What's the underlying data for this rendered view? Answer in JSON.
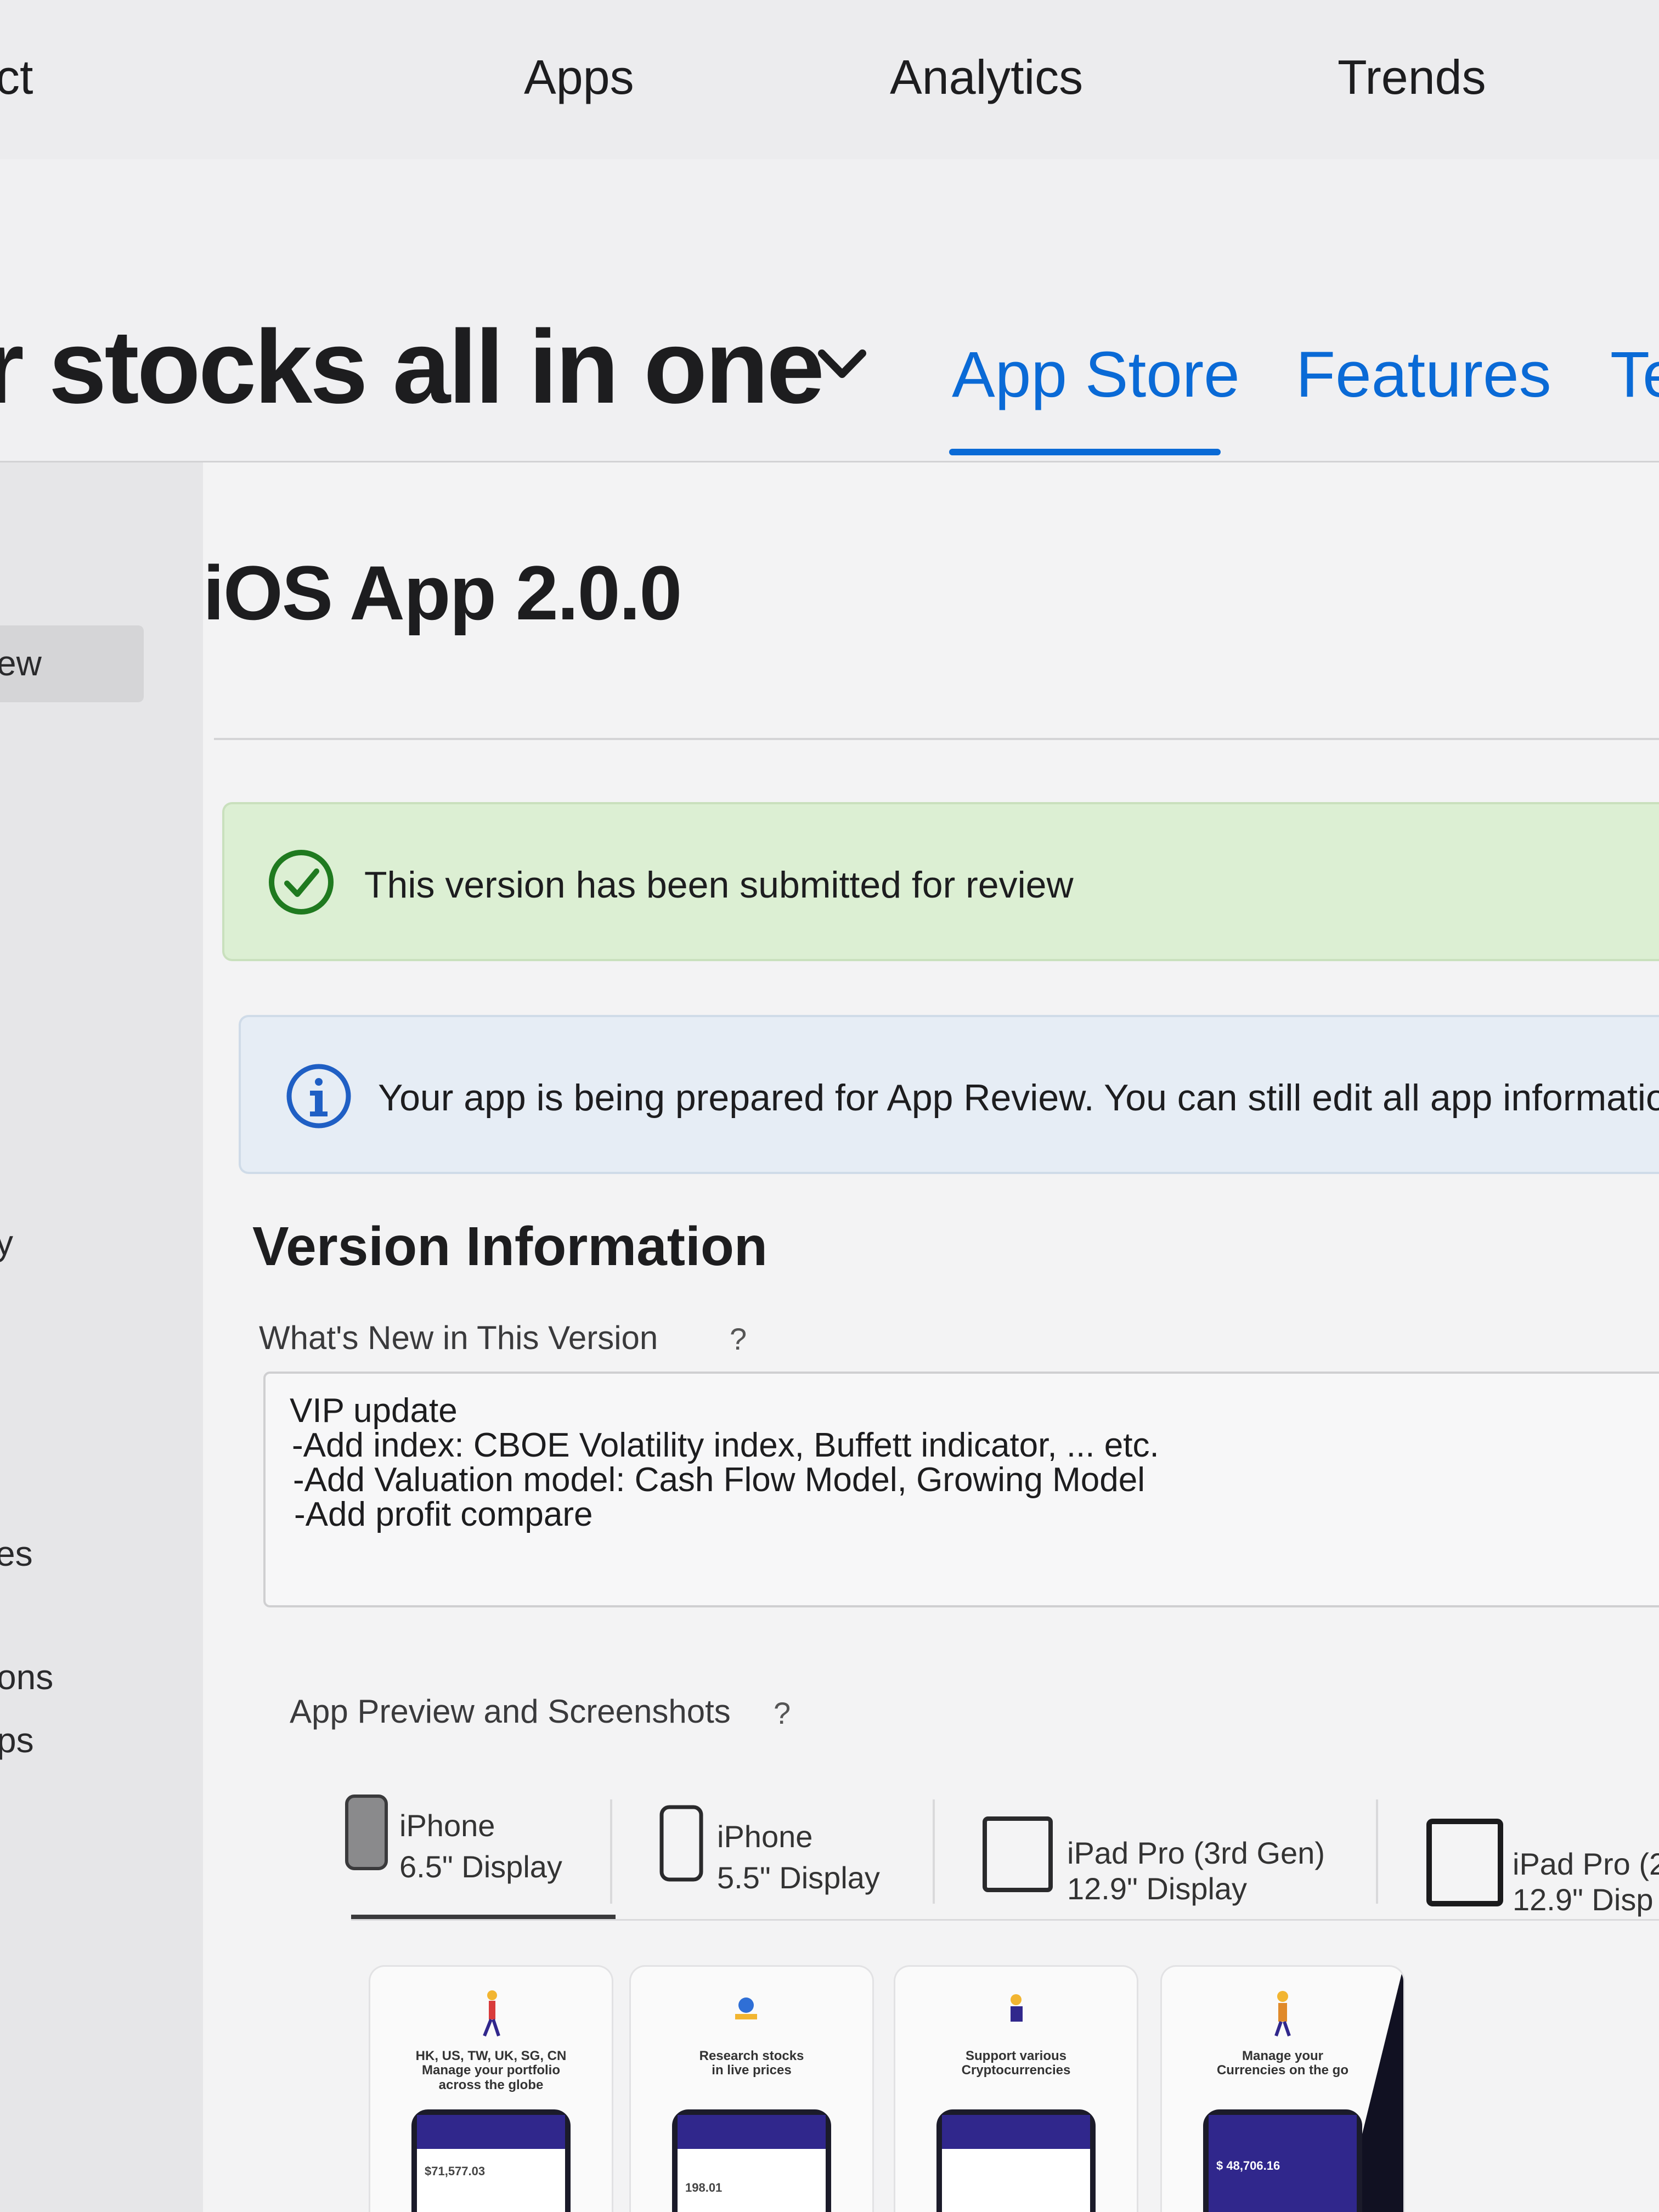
{
  "top_nav": {
    "partial_left": "ct",
    "items": [
      "Apps",
      "Analytics",
      "Trends"
    ]
  },
  "app": {
    "name_partial": "r stocks all in one",
    "tabs": [
      "App Store",
      "Features",
      "Te"
    ],
    "active_tab": "App Store"
  },
  "sidebar": {
    "items": [
      "ew",
      "y",
      "es",
      "ons",
      "ps"
    ]
  },
  "page": {
    "title": "iOS App 2.0.0"
  },
  "banners": {
    "submitted": "This version has been submitted for review",
    "info": "Your app is being prepared for App Review. You can still edit all app information"
  },
  "version_info": {
    "title": "Version Information",
    "whats_new_label": "What's New in This Version",
    "help": "?",
    "whats_new_lines": [
      "VIP update",
      "-Add index: CBOE Volatility index, Buffett indicator, ... etc.",
      "-Add Valuation model: Cash Flow Model, Growing Model",
      "-Add profit compare"
    ]
  },
  "previews": {
    "label": "App Preview and Screenshots",
    "help": "?",
    "devices": [
      {
        "line1": "iPhone",
        "line2": "6.5\" Display",
        "selected": true
      },
      {
        "line1": "iPhone",
        "line2": "5.5\" Display",
        "selected": false
      },
      {
        "line1": "iPad Pro (3rd Gen)",
        "line2": "12.9\" Display",
        "selected": false
      },
      {
        "line1": "iPad Pro (2",
        "line2": "12.9\" Disp",
        "selected": false
      }
    ],
    "screenshots": [
      {
        "caption1": "HK, US, TW, UK, SG, CN",
        "caption2": "Manage your portfolio",
        "caption3": "across the globe",
        "value": "$71,577.03"
      },
      {
        "caption1": "Research stocks",
        "caption2": "in live prices",
        "caption3": "",
        "value": "198.01"
      },
      {
        "caption1": "Support various",
        "caption2": "Cryptocurrencies",
        "caption3": "",
        "value": ""
      },
      {
        "caption1": "Manage your",
        "caption2": "Currencies on the go",
        "caption3": "",
        "value": "$ 48,706.16"
      }
    ]
  },
  "colors": {
    "accent": "#0a6ad6",
    "success": "#1f7a1f",
    "info": "#1f5fc4"
  }
}
